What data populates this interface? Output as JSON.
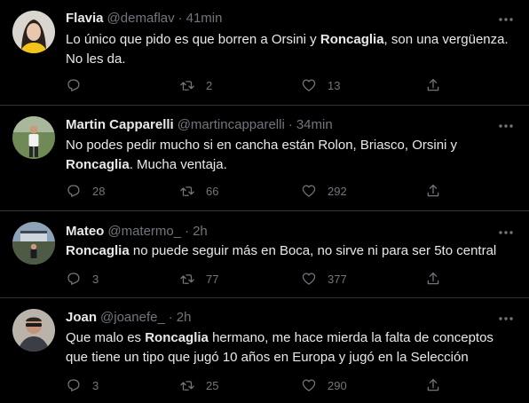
{
  "tweets": [
    {
      "name": "Flavia",
      "handle": "@demaflav",
      "dot": "·",
      "time": "41min",
      "text_segments": [
        {
          "text": "Lo único que pido es que borren a Orsini y ",
          "bold": false
        },
        {
          "text": "Roncaglia",
          "bold": true
        },
        {
          "text": ", son una vergüenza. No les da.",
          "bold": false
        }
      ],
      "replies": "",
      "retweets": "2",
      "likes": "13",
      "avatar_icon": "woman-avatar"
    },
    {
      "name": "Martin Capparelli",
      "handle": "@martincapparelli",
      "dot": "·",
      "time": "34min",
      "text_segments": [
        {
          "text": "No podes pedir mucho si en cancha están Rolon, Briasco, Orsini y ",
          "bold": false
        },
        {
          "text": "Roncaglia",
          "bold": true
        },
        {
          "text": ". Mucha ventaja.",
          "bold": false
        }
      ],
      "replies": "28",
      "retweets": "66",
      "likes": "292",
      "avatar_icon": "man-standing-outdoors-avatar"
    },
    {
      "name": "Mateo",
      "handle": "@matermo_",
      "dot": "·",
      "time": "2h",
      "text_segments": [
        {
          "text": "Roncaglia",
          "bold": true
        },
        {
          "text": " no puede seguir más en Boca, no sirve ni para ser 5to central",
          "bold": false
        }
      ],
      "replies": "3",
      "retweets": "77",
      "likes": "377",
      "avatar_icon": "stadium-avatar"
    },
    {
      "name": "Joan",
      "handle": "@joanefe_",
      "dot": "·",
      "time": "2h",
      "text_segments": [
        {
          "text": "Que malo es ",
          "bold": false
        },
        {
          "text": "Roncaglia",
          "bold": true
        },
        {
          "text": " hermano, me hace mierda la falta de conceptos que tiene un tipo que jugó 10 años en Europa y jugó en la Selección",
          "bold": false
        }
      ],
      "replies": "3",
      "retweets": "25",
      "likes": "290",
      "avatar_icon": "man-portrait-avatar"
    }
  ],
  "icons": {
    "reply": "reply-icon",
    "retweet": "retweet-icon",
    "like": "heart-icon",
    "share": "share-icon",
    "more": "more-icon"
  },
  "colors": {
    "background": "#000000",
    "text": "#e7e9ea",
    "secondary": "#71767b",
    "divider": "#2f3336"
  }
}
